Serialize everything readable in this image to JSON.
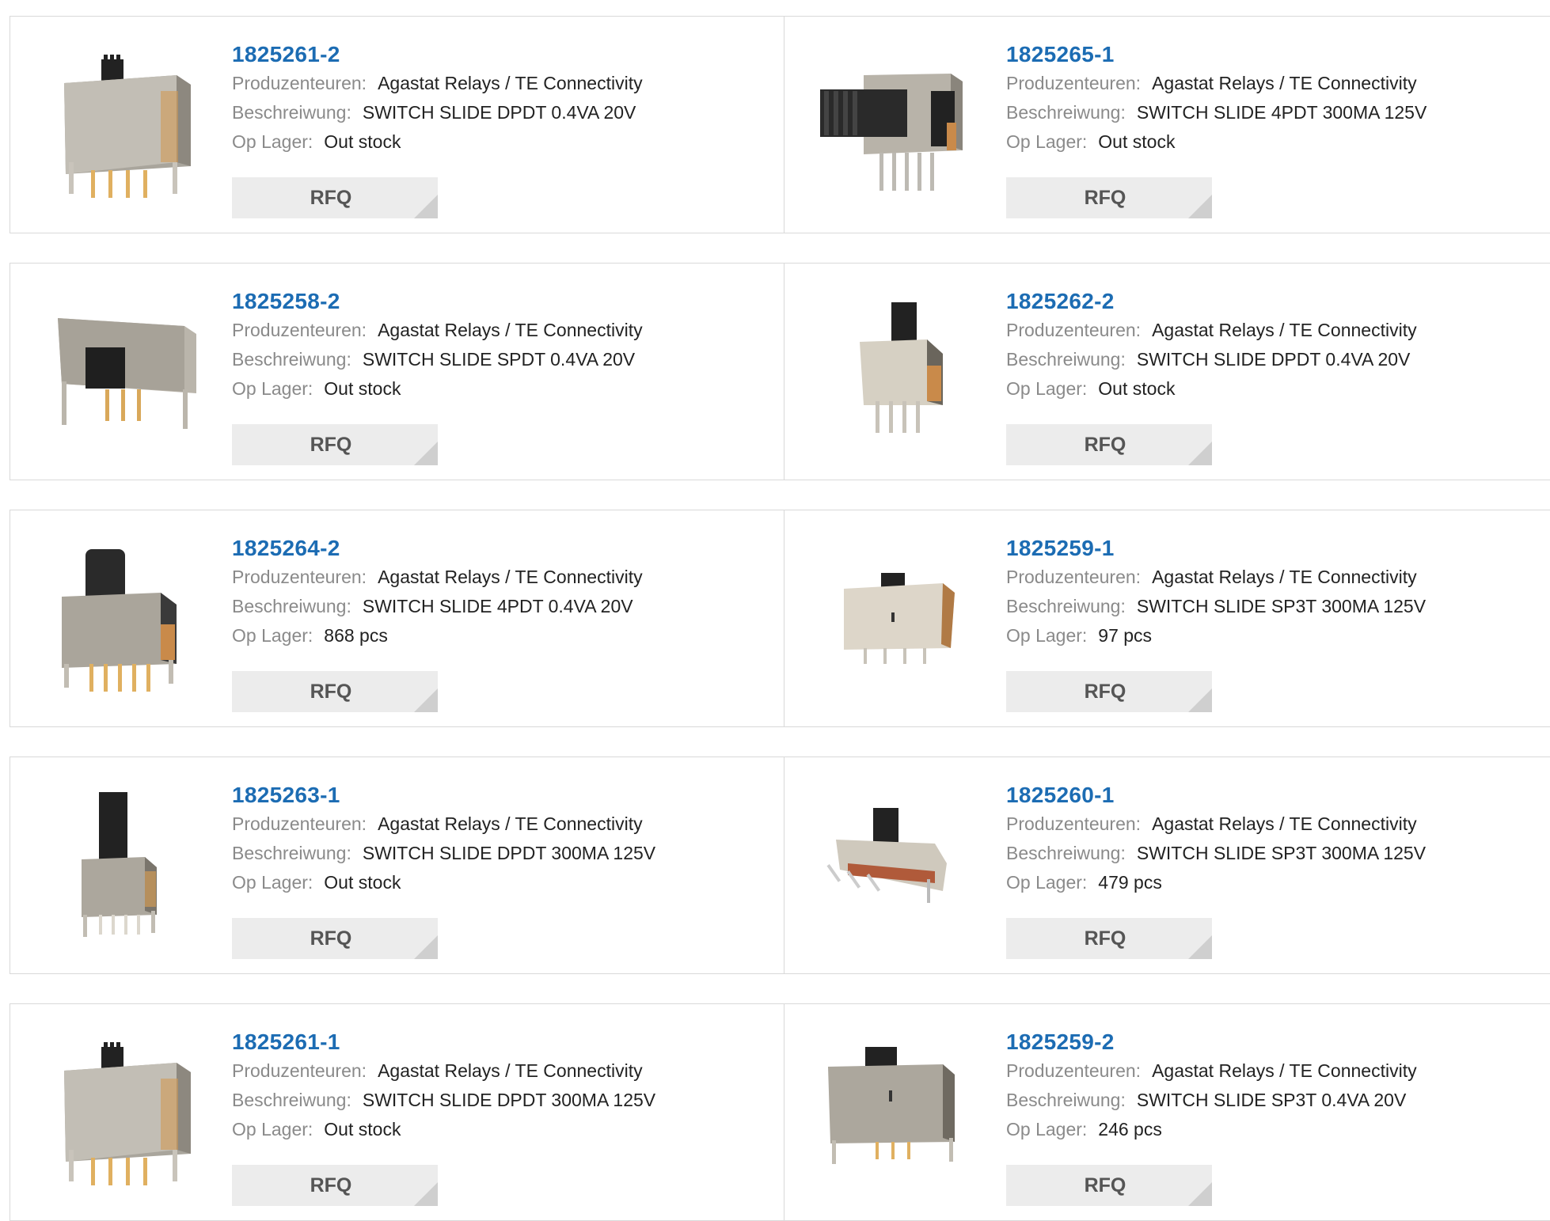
{
  "labels": {
    "manufacturer": "Produzenteuren:",
    "description": "Beschreiwung:",
    "stock": "Op Lager:",
    "rfq": "RFQ"
  },
  "colors": {
    "part_number": "#1c6cb3",
    "label": "#8a8a8a",
    "border": "#d9d9d9",
    "button_bg": "#ececec"
  },
  "products": [
    {
      "pn": "1825261-2",
      "manufacturer": "Agastat Relays / TE Connectivity",
      "description": "SWITCH SLIDE DPDT 0.4VA 20V",
      "stock": "Out stock"
    },
    {
      "pn": "1825265-1",
      "manufacturer": "Agastat Relays / TE Connectivity",
      "description": "SWITCH SLIDE 4PDT 300MA 125V",
      "stock": "Out stock"
    },
    {
      "pn": "1825258-2",
      "manufacturer": "Agastat Relays / TE Connectivity",
      "description": "SWITCH SLIDE SPDT 0.4VA 20V",
      "stock": "Out stock"
    },
    {
      "pn": "1825262-2",
      "manufacturer": "Agastat Relays / TE Connectivity",
      "description": "SWITCH SLIDE DPDT 0.4VA 20V",
      "stock": "Out stock"
    },
    {
      "pn": "1825264-2",
      "manufacturer": "Agastat Relays / TE Connectivity",
      "description": "SWITCH SLIDE 4PDT 0.4VA 20V",
      "stock": "868 pcs"
    },
    {
      "pn": "1825259-1",
      "manufacturer": "Agastat Relays / TE Connectivity",
      "description": "SWITCH SLIDE SP3T 300MA 125V",
      "stock": "97 pcs"
    },
    {
      "pn": "1825263-1",
      "manufacturer": "Agastat Relays / TE Connectivity",
      "description": "SWITCH SLIDE DPDT 300MA 125V",
      "stock": "Out stock"
    },
    {
      "pn": "1825260-1",
      "manufacturer": "Agastat Relays / TE Connectivity",
      "description": "SWITCH SLIDE SP3T 300MA 125V",
      "stock": "479 pcs"
    },
    {
      "pn": "1825261-1",
      "manufacturer": "Agastat Relays / TE Connectivity",
      "description": "SWITCH SLIDE DPDT 300MA 125V",
      "stock": "Out stock"
    },
    {
      "pn": "1825259-2",
      "manufacturer": "Agastat Relays / TE Connectivity",
      "description": "SWITCH SLIDE SP3T 0.4VA 20V",
      "stock": "246 pcs"
    }
  ]
}
